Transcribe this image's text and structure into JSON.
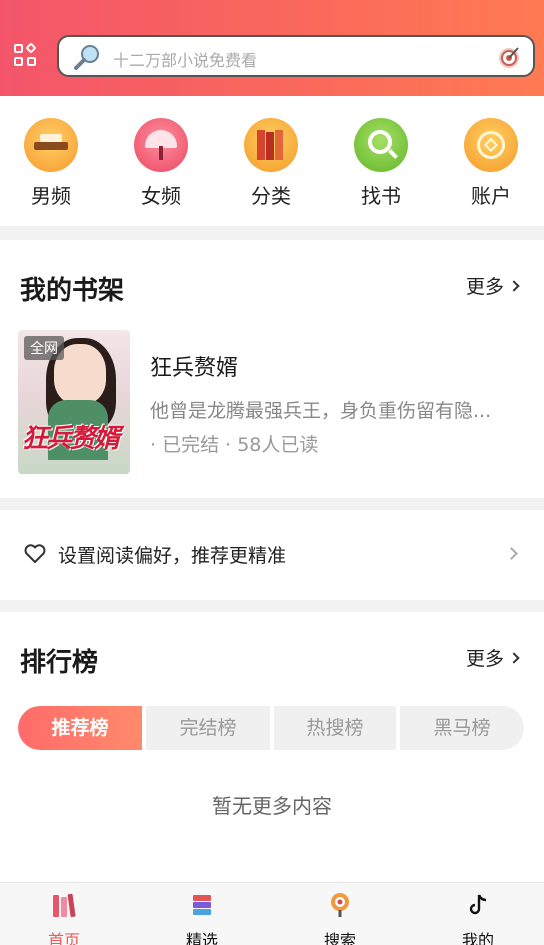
{
  "header": {
    "search_placeholder": "十二万部小说免费看"
  },
  "categories": [
    {
      "label": "男频",
      "color": "#f7a23b"
    },
    {
      "label": "女频",
      "color": "#f0566a"
    },
    {
      "label": "分类",
      "color": "#f4a437"
    },
    {
      "label": "找书",
      "color": "#7bc53a"
    },
    {
      "label": "账户",
      "color": "#f7a23b"
    }
  ],
  "bookshelf": {
    "title": "我的书架",
    "more": "更多",
    "book": {
      "cover_tag": "全网",
      "cover_title": "狂兵赘婿",
      "name": "狂兵赘婿",
      "description": "他曾是龙腾最强兵王，身负重伤留有隐...",
      "meta": "· 已完结 · 58人已读"
    }
  },
  "preference": {
    "text": "设置阅读偏好，推荐更精准"
  },
  "rankings": {
    "title": "排行榜",
    "more": "更多",
    "tabs": [
      "推荐榜",
      "完结榜",
      "热搜榜",
      "黑马榜"
    ],
    "active_tab": 0,
    "empty_text": "暂无更多内容"
  },
  "nav": [
    {
      "label": "首页",
      "icon": "books-icon",
      "active": true
    },
    {
      "label": "精选",
      "icon": "book-stack-icon",
      "active": false
    },
    {
      "label": "搜索",
      "icon": "search-pin-icon",
      "active": false
    },
    {
      "label": "我的",
      "icon": "tiktok-icon",
      "active": false
    }
  ],
  "colors": {
    "accent": "#f05a5a",
    "header_start": "#f4556a",
    "header_end": "#ff7b52"
  }
}
